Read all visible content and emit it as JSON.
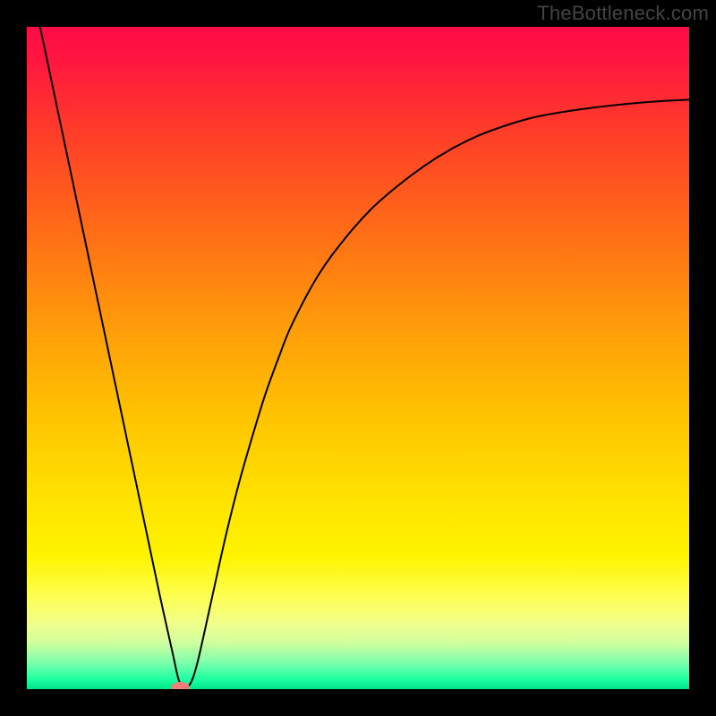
{
  "watermark": "TheBottleneck.com",
  "chart_data": {
    "type": "line",
    "title": "",
    "xlabel": "",
    "ylabel": "",
    "xlim": [
      0,
      100
    ],
    "ylim": [
      0,
      100
    ],
    "gradient_stops": [
      {
        "offset": 0.0,
        "color": "#ff0b46"
      },
      {
        "offset": 0.05,
        "color": "#ff1640"
      },
      {
        "offset": 0.15,
        "color": "#ff3a2a"
      },
      {
        "offset": 0.3,
        "color": "#ff6a17"
      },
      {
        "offset": 0.45,
        "color": "#ff9b0a"
      },
      {
        "offset": 0.6,
        "color": "#ffc700"
      },
      {
        "offset": 0.72,
        "color": "#ffe400"
      },
      {
        "offset": 0.8,
        "color": "#fff400"
      },
      {
        "offset": 0.86,
        "color": "#fdff52"
      },
      {
        "offset": 0.9,
        "color": "#f1ff8a"
      },
      {
        "offset": 0.93,
        "color": "#d0ff9e"
      },
      {
        "offset": 0.96,
        "color": "#7dffad"
      },
      {
        "offset": 0.985,
        "color": "#1effa0"
      },
      {
        "offset": 1.0,
        "color": "#00e48a"
      }
    ],
    "series": [
      {
        "name": "bottleneck-curve",
        "x": [
          2,
          4,
          6,
          8,
          10,
          12,
          14,
          16,
          18,
          20,
          22,
          23,
          24,
          25,
          26,
          28,
          30,
          32,
          34,
          36,
          38,
          40,
          44,
          48,
          52,
          56,
          60,
          64,
          68,
          72,
          76,
          80,
          84,
          88,
          92,
          96,
          100
        ],
        "y": [
          100,
          90.5,
          81,
          71.5,
          62,
          52.5,
          43,
          33.5,
          24,
          14.5,
          5.5,
          1.2,
          0.2,
          1.5,
          5,
          14,
          23,
          31,
          38,
          44.5,
          50,
          55,
          62.5,
          68,
          72.5,
          76,
          79,
          81.5,
          83.5,
          85,
          86.2,
          87,
          87.6,
          88.1,
          88.5,
          88.8,
          89
        ]
      }
    ],
    "marker": {
      "x": 23.2,
      "y": 0.2,
      "color": "#ff7a7a"
    }
  }
}
